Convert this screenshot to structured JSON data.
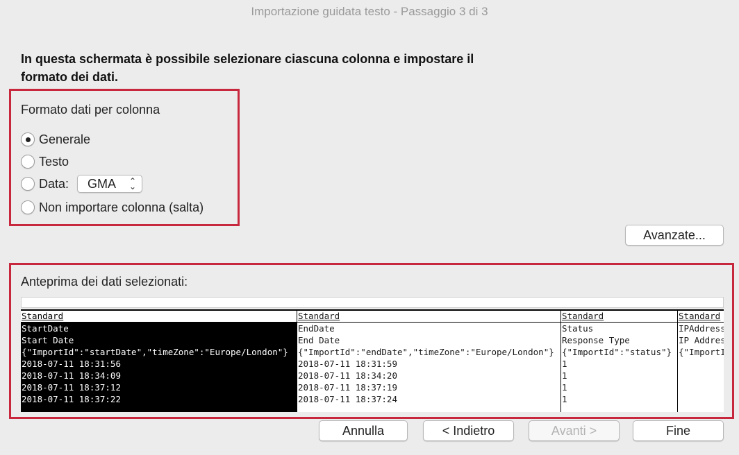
{
  "window": {
    "title": "Importazione guidata testo - Passaggio 3 di 3"
  },
  "instructions": "In questa schermata è possibile selezionare ciascuna colonna e impostare il formato dei dati.",
  "format": {
    "title": "Formato dati per colonna",
    "options": [
      {
        "label": "Generale",
        "selected": true
      },
      {
        "label": "Testo",
        "selected": false
      },
      {
        "label": "Data:",
        "selected": false
      },
      {
        "label": "Non importare colonna (salta)",
        "selected": false
      }
    ],
    "date_select": "GMA"
  },
  "advanced_button": "Avanzate...",
  "preview": {
    "title": "Anteprima dei dati selezionati:",
    "columns": [
      {
        "header": "Standard",
        "selected": true,
        "cells": [
          "StartDate",
          "Start Date",
          "{\"ImportId\":\"startDate\",\"timeZone\":\"Europe/London\"}",
          "2018-07-11 18:31:56",
          "2018-07-11 18:34:09",
          "2018-07-11 18:37:12",
          "2018-07-11 18:37:22"
        ]
      },
      {
        "header": "Standard",
        "selected": false,
        "cells": [
          "EndDate",
          "End Date",
          "{\"ImportId\":\"endDate\",\"timeZone\":\"Europe/London\"}",
          "2018-07-11 18:31:59",
          "2018-07-11 18:34:20",
          "2018-07-11 18:37:19",
          "2018-07-11 18:37:24"
        ]
      },
      {
        "header": "Standard",
        "selected": false,
        "cells": [
          "Status",
          "Response Type",
          "{\"ImportId\":\"status\"}",
          "1",
          "1",
          "1",
          "1"
        ]
      },
      {
        "header": "Standard",
        "selected": false,
        "cells": [
          "IPAddress",
          "IP Address",
          "{\"ImportId\":\"ipAddress\"}",
          "",
          "",
          "",
          ""
        ]
      }
    ]
  },
  "buttons": {
    "cancel": "Annulla",
    "back": "< Indietro",
    "next": "Avanti >",
    "finish": "Fine"
  }
}
